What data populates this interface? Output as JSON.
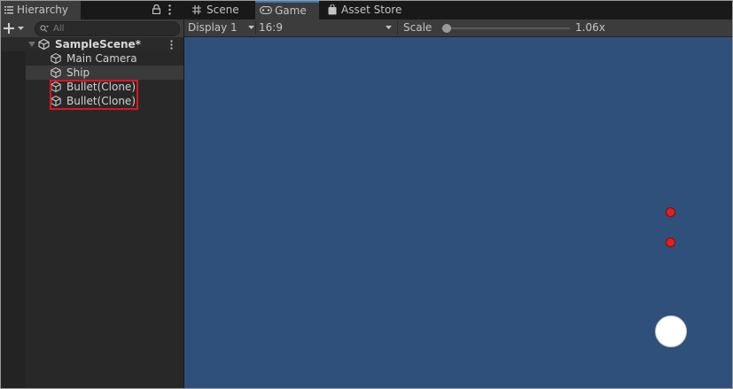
{
  "hierarchy": {
    "tab_label": "Hierarchy",
    "search_placeholder": "All",
    "scene_name": "SampleScene*",
    "items": [
      {
        "label": "Main Camera"
      },
      {
        "label": "Ship"
      },
      {
        "label": "Bullet(Clone)"
      },
      {
        "label": "Bullet(Clone)"
      }
    ]
  },
  "tabs": [
    {
      "label": "Scene",
      "icon": "grid-icon"
    },
    {
      "label": "Game",
      "icon": "gamepad-icon"
    },
    {
      "label": "Asset Store",
      "icon": "bag-icon"
    }
  ],
  "game_toolbar": {
    "display": "Display 1",
    "aspect": "16:9",
    "scale_label": "Scale",
    "scale_value": "1.06x",
    "scale_fraction": 0.0
  },
  "colors": {
    "viewport_bg": "#2f507a",
    "bullet": "#e3201b",
    "ship": "#ffffff",
    "selection_outline": "#e0141e"
  }
}
